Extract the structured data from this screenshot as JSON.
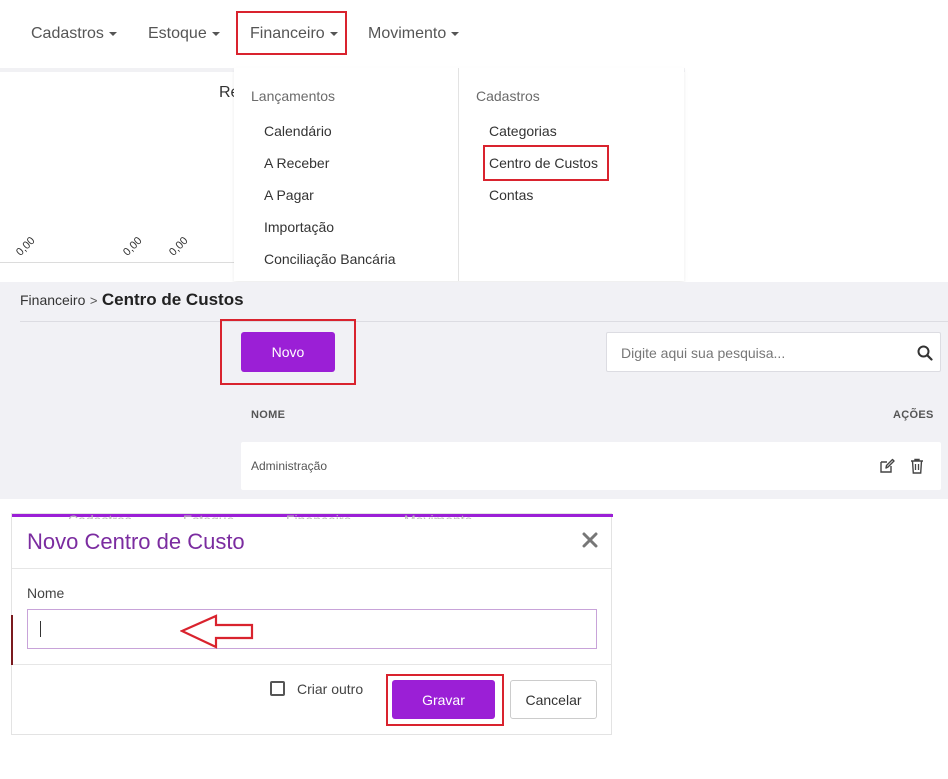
{
  "nav": {
    "items": [
      {
        "label": "Cadastros"
      },
      {
        "label": "Estoque"
      },
      {
        "label": "Financeiro"
      },
      {
        "label": "Movimento"
      }
    ]
  },
  "chart": {
    "title_partial": "Re",
    "zero_labels": [
      "0,00",
      "0,00",
      "0,00"
    ]
  },
  "dropdown": {
    "left_header": "Lançamentos",
    "left_items": [
      "Calendário",
      "A Receber",
      "A Pagar",
      "Importação",
      "Conciliação Bancária"
    ],
    "right_header": "Cadastros",
    "right_items": [
      "Categorias",
      "Centro de Custos",
      "Contas"
    ]
  },
  "page": {
    "breadcrumb_root": "Financeiro",
    "breadcrumb_sep": ">",
    "breadcrumb_current": "Centro de Custos",
    "new_button": "Novo",
    "search_placeholder": "Digite aqui sua pesquisa...",
    "table": {
      "col_name": "NOME",
      "col_actions": "AÇÕES",
      "rows": [
        {
          "name": "Administração"
        }
      ]
    }
  },
  "modal": {
    "title": "Novo Centro de Custo",
    "name_label": "Nome",
    "name_value": "",
    "checkbox_label": "Criar outro",
    "save_button": "Gravar",
    "cancel_button": "Cancelar"
  },
  "colors": {
    "accent": "#9b1fd6",
    "highlight": "#d9232e"
  }
}
